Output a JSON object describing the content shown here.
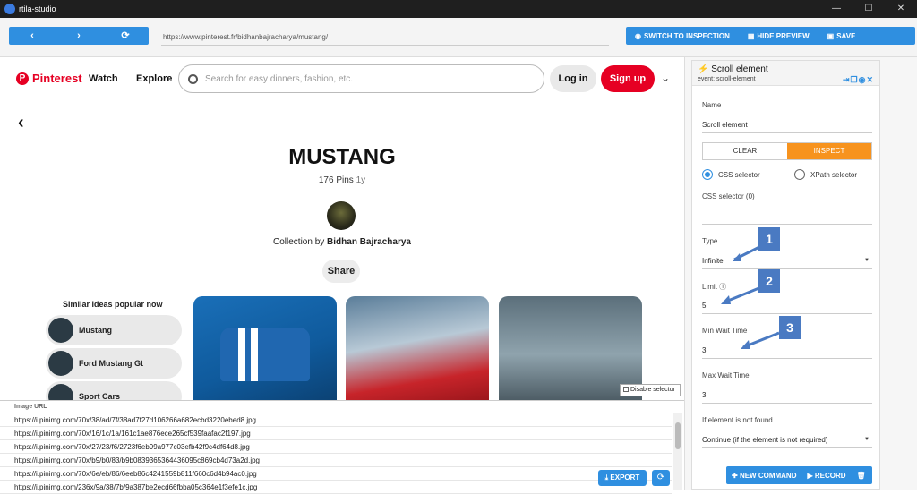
{
  "window": {
    "title": "rtila-studio",
    "controls": [
      "—",
      "☐",
      "✕"
    ]
  },
  "toolbar": {
    "back_glyph": "‹",
    "forward_glyph": "›",
    "reload_glyph": "⟳",
    "url": "https://www.pinterest.fr/bidhanbajracharya/mustang/",
    "switch_label": "SWITCH TO INSPECTION",
    "hide_label": "HIDE PREVIEW",
    "save_label": "SAVE"
  },
  "pinterest": {
    "logo_text": "Pinterest",
    "logo_glyph": "P",
    "nav": [
      "Watch",
      "Explore"
    ],
    "search_placeholder": "Search for easy dinners, fashion, etc.",
    "login_label": "Log in",
    "signup_label": "Sign up",
    "board_title": "MUSTANG",
    "pins_count": "176 Pins",
    "pins_age": "1y",
    "collection_prefix": "Collection by",
    "collection_author": "Bidhan Bajracharya",
    "share_label": "Share",
    "similar_title": "Similar ideas popular now",
    "similar_items": [
      "Mustang",
      "Ford Mustang Gt",
      "Sport Cars"
    ],
    "disable_selector_label": "Disable selector"
  },
  "url_list": {
    "header": "Image URL",
    "rows": [
      "https://i.pinimg.com/70x/38/ad/7f/38ad7f27d106266a682ecbd3220ebed8.jpg",
      "https://i.pinimg.com/70x/16/1c/1a/161c1ae876ece265cf539faafac2f197.jpg",
      "https://i.pinimg.com/70x/27/23/f6/2723f6eb99a977c03efb42f9c4df64d8.jpg",
      "https://i.pinimg.com/70x/b9/b0/83/b9b0839365364436095c869cb4d73a2d.jpg",
      "https://i.pinimg.com/70x/6e/eb/86/6eeb86c4241559b811f660c6d4b94ac0.jpg",
      "https://i.pinimg.com/236x/9a/38/7b/9a387be2ecd66fbba05c364e1f3efe1c.jpg"
    ],
    "export_label": "EXPORT"
  },
  "panel": {
    "title": "Scroll element",
    "event": "event:  scroll-element",
    "name_label": "Name",
    "name_value": "Scroll element",
    "clear_label": "CLEAR",
    "inspect_label": "INSPECT",
    "css_radio": "CSS selector",
    "xpath_radio": "XPath selector",
    "css_selector_label": "CSS selector (0)",
    "type_label": "Type",
    "type_value": "Infinite",
    "limit_label": "Limit",
    "limit_value": "5",
    "min_wait_label": "Min Wait Time",
    "min_wait_value": "3",
    "max_wait_label": "Max Wait Time",
    "max_wait_value": "3",
    "not_found_label": "If element is not found",
    "not_found_value": "Continue (if the element is not required)",
    "new_command_label": "NEW COMMAND",
    "record_label": "RECORD"
  },
  "badges": [
    "1",
    "2",
    "3"
  ],
  "colors": {
    "accent": "#2f8fe0",
    "inspect": "#f7931e",
    "pinterest": "#e60023",
    "badge": "#4a7ac2"
  }
}
